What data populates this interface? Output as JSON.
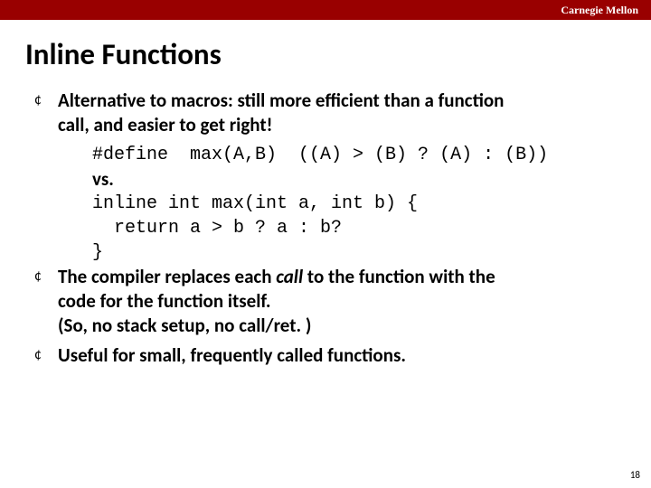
{
  "header": {
    "brand": "Carnegie Mellon"
  },
  "title": "Inline Functions",
  "bullet_glyph": "¢",
  "b1_a": "Alternative to macros: still more efficient than a function",
  "b1_b": "call, and easier to get right!",
  "code_define": "#define  max(A,B)  ((A) > (B) ? (A) : (B))",
  "vs": "vs.",
  "code_inline_1": "inline int max(int a, int b) {",
  "code_inline_2": "  return a > b ? a : b?",
  "code_inline_3": "}",
  "b2_a_pre": "The compiler replaces each ",
  "b2_a_ital": "call",
  "b2_a_post": " to the function with the",
  "b2_b": "code for the function itself.",
  "b2_c": "(So, no stack setup, no call/ret. )",
  "b3": "Useful for small, frequently called functions.",
  "page_number": "18"
}
